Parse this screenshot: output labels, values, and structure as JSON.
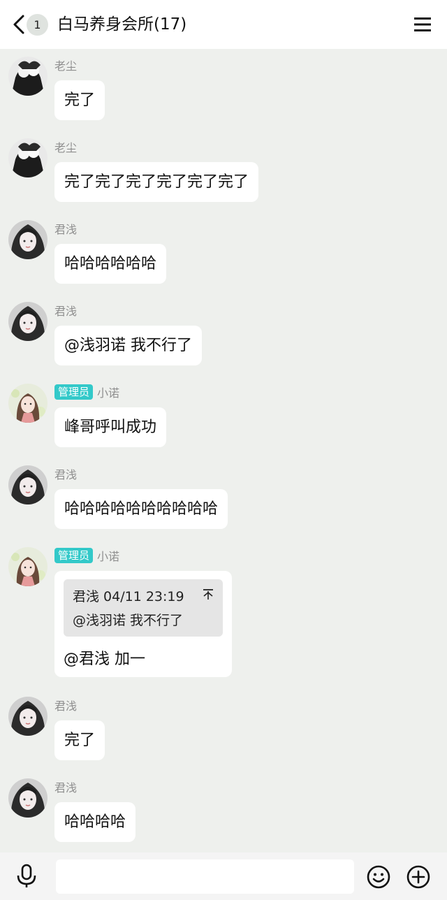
{
  "header": {
    "unread_count": "1",
    "title": "白马养身会所(17)"
  },
  "messages": [
    {
      "sender": "老尘",
      "text": "完了"
    },
    {
      "sender": "老尘",
      "text": "完了完了完了完了完了完了"
    },
    {
      "sender": "君浅",
      "text": "哈哈哈哈哈哈"
    },
    {
      "sender": "君浅",
      "text": "@浅羽诺 我不行了"
    },
    {
      "role_tag": "管理员",
      "sender": "小诺",
      "text": "峰哥呼叫成功"
    },
    {
      "sender": "君浅",
      "text": "哈哈哈哈哈哈哈哈哈哈"
    },
    {
      "role_tag": "管理员",
      "sender": "小诺",
      "quote_meta": "君浅 04/11 23:19",
      "quote_text": "@浅羽诺 我不行了",
      "text": "@君浅 加一"
    },
    {
      "sender": "君浅",
      "text": "完了"
    },
    {
      "sender": "君浅",
      "text": "哈哈哈哈"
    }
  ],
  "input": {
    "placeholder": "",
    "value": ""
  },
  "colors": {
    "admin_tag": "#33c9c9",
    "chat_bg": "#eef0ed",
    "bubble": "#ffffff"
  },
  "icons": {
    "back": "chevron-left-icon",
    "menu": "hamburger-icon",
    "mic": "mic-icon",
    "emoji": "smiley-icon",
    "plus": "plus-circle-icon",
    "quote": "quote-jump-icon"
  }
}
